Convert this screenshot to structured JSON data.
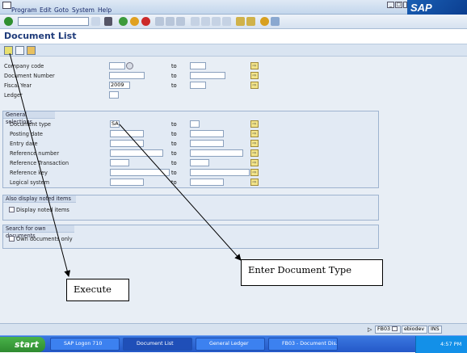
{
  "menu": {
    "items": [
      "Program",
      "Edit",
      "Goto",
      "System",
      "Help"
    ]
  },
  "window": {
    "brand": "SAP"
  },
  "page": {
    "title": "Document List"
  },
  "fields": [
    {
      "label": "Company code",
      "from": "",
      "has_to": true
    },
    {
      "label": "Document Number",
      "from": "",
      "has_to": true
    },
    {
      "label": "Fiscal Year",
      "from": "2009",
      "has_to": true
    },
    {
      "label": "Ledger",
      "from": "",
      "has_to": false
    }
  ],
  "to_label": "to",
  "general_selections": {
    "title": "General selections",
    "fields": [
      {
        "label": "Document type",
        "from": "SA"
      },
      {
        "label": "Posting date",
        "from": ""
      },
      {
        "label": "Entry date",
        "from": ""
      },
      {
        "label": "Reference number",
        "from": ""
      },
      {
        "label": "Reference Transaction",
        "from": ""
      },
      {
        "label": "Reference key",
        "from": ""
      },
      {
        "label": "Logical system",
        "from": ""
      }
    ]
  },
  "noted_items": {
    "title": "Also display noted items",
    "checkbox": "Display noted items",
    "checked": false
  },
  "own_docs": {
    "title": "Search for own documents",
    "checkbox": "Own documents only",
    "checked": false
  },
  "callouts": {
    "enter_doc_type": "Enter Document Type",
    "execute": "Execute"
  },
  "status": {
    "tcode": "FB03",
    "user": "ebiodev",
    "mode": "INS"
  },
  "taskbar": {
    "start": "start",
    "tasks": [
      "SAP Logon 710",
      "Document List",
      "General Ledger",
      "FB03 - Document Dis..."
    ],
    "clock": "4:57 PM"
  }
}
